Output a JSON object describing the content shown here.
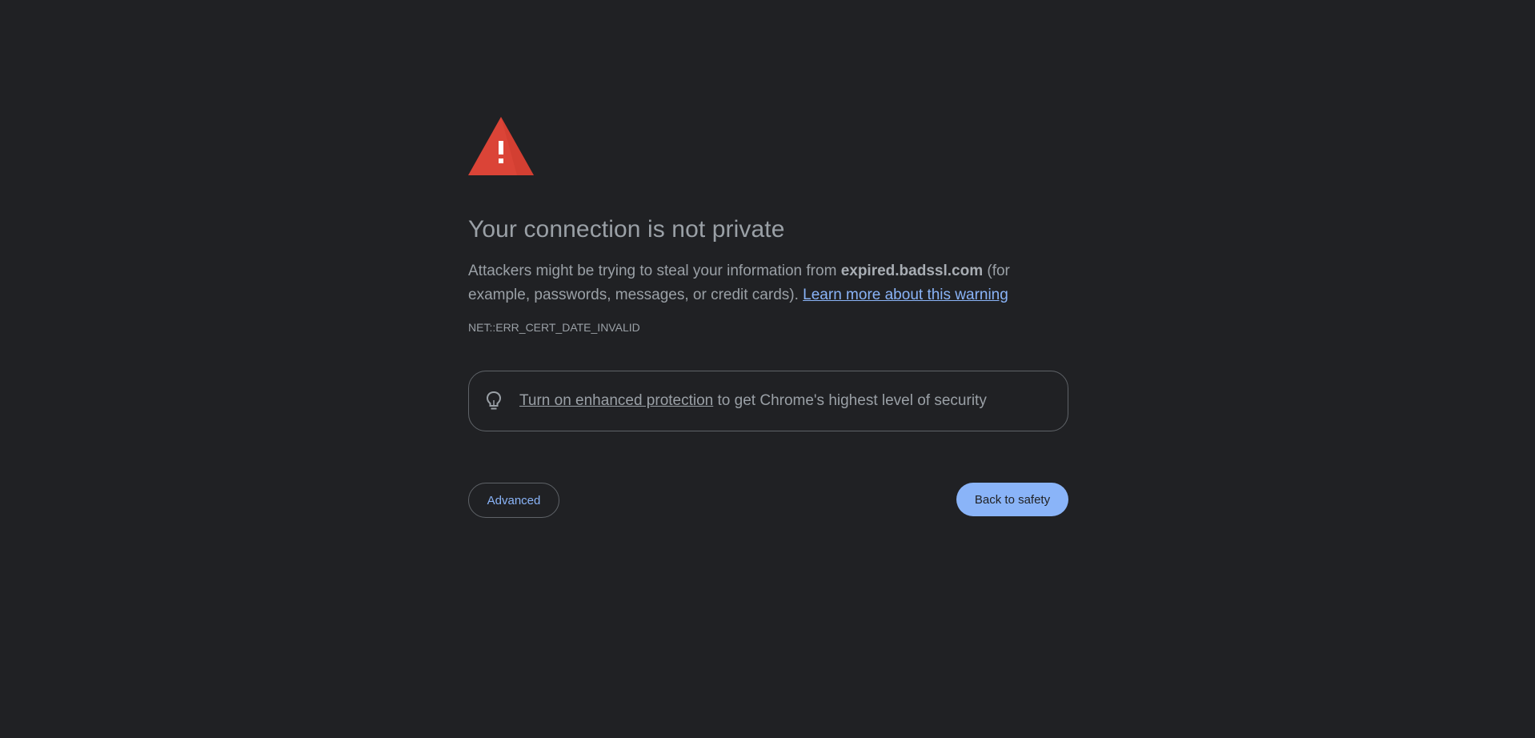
{
  "interstitial": {
    "title": "Your connection is not private",
    "description_before": "Attackers might be trying to steal your information from ",
    "domain": "expired.badssl.com",
    "description_after": " (for example, passwords, messages, or credit cards). ",
    "learn_more_link": "Learn more about this warning",
    "error_code": "NET::ERR_CERT_DATE_INVALID"
  },
  "enhanced_protection": {
    "icon": "lightbulb-icon",
    "link_text": "Turn on enhanced protection",
    "suffix_text": " to get Chrome's highest level of security"
  },
  "actions": {
    "advanced_label": "Advanced",
    "back_label": "Back to safety"
  },
  "colors": {
    "background": "#202124",
    "text": "#9aa0a6",
    "link": "#8ab4f8",
    "warning_red": "#db4437",
    "primary_button": "#8ab4f8",
    "border": "#5f6368"
  },
  "icons": {
    "warning": "warning-triangle-icon",
    "bulb": "lightbulb-icon"
  }
}
